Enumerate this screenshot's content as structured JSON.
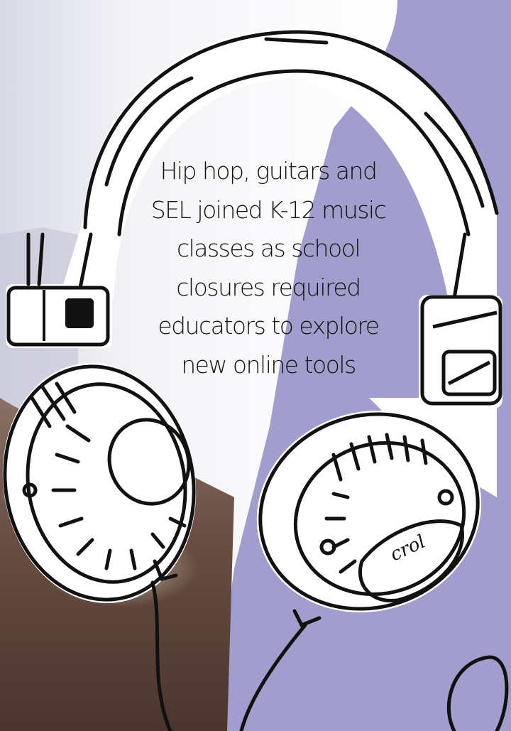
{
  "headline": {
    "lines": [
      "Hip hop, guitars and",
      "SEL joined K-12 music",
      "classes as school",
      "closures required",
      "educators to explore",
      "new online tools"
    ]
  },
  "cup_mark": "crol",
  "colors": {
    "background_purple": "#a19dcc",
    "ink": "#111111",
    "paper": "#ffffff",
    "floor_brown": "#6a4f43"
  },
  "illustration": "hand-drawn-headphones"
}
